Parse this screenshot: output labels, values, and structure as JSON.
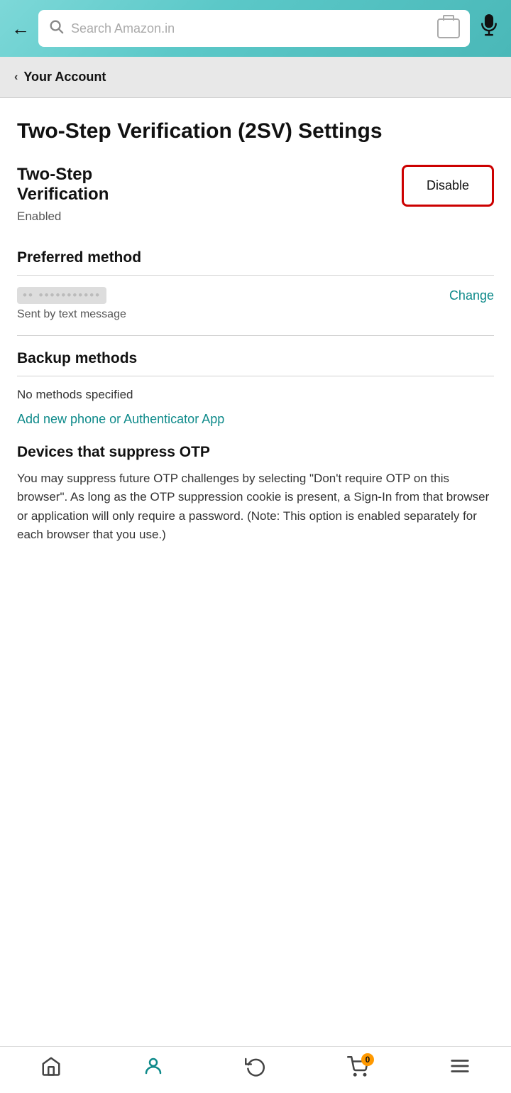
{
  "header": {
    "search_placeholder": "Search Amazon.in",
    "back_label": "←"
  },
  "breadcrumb": {
    "chevron": "‹",
    "text": "Your Account"
  },
  "page": {
    "title": "Two-Step Verification (2SV) Settings"
  },
  "two_step_verification": {
    "label_line1": "Two-Step",
    "label_line2": "Verification",
    "status": "Enabled",
    "disable_button": "Disable"
  },
  "preferred_method": {
    "title": "Preferred method",
    "phone_placeholder": "•• •••••••••••",
    "change_link": "Change",
    "description": "Sent by text message"
  },
  "backup_methods": {
    "title": "Backup methods",
    "no_methods_text": "No methods specified",
    "add_link": "Add new phone or Authenticator App"
  },
  "otp_devices": {
    "title": "Devices that suppress OTP",
    "description": "You may suppress future OTP challenges by selecting \"Don't require OTP on this browser\". As long as the OTP suppression cookie is present, a Sign-In from that browser or application will only require a password. (Note: This option is enabled separately for each browser that you use.)"
  },
  "bottom_nav": {
    "home_label": "Home",
    "account_label": "Account",
    "returns_label": "Returns",
    "cart_label": "Cart",
    "cart_count": "0",
    "menu_label": "Menu"
  }
}
